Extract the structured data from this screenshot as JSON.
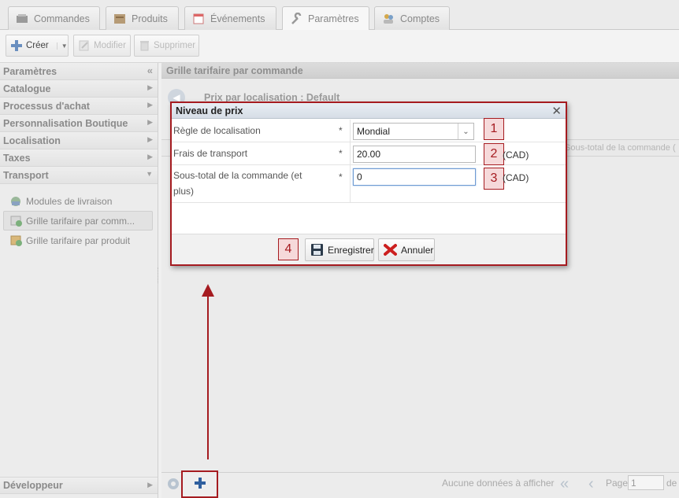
{
  "tabs": [
    {
      "label": "Commandes",
      "icon": "orders-icon"
    },
    {
      "label": "Produits",
      "icon": "products-icon"
    },
    {
      "label": "Événements",
      "icon": "events-icon"
    },
    {
      "label": "Paramètres",
      "icon": "wrench-icon",
      "active": true
    },
    {
      "label": "Comptes",
      "icon": "accounts-icon"
    }
  ],
  "toolbar": {
    "create_label": "Créer",
    "modify_label": "Modifier",
    "delete_label": "Supprimer"
  },
  "sidebar": {
    "header": "Paramètres",
    "sections": [
      "Catalogue",
      "Processus d'achat",
      "Personnalisation Boutique",
      "Localisation",
      "Taxes"
    ],
    "expanded_section": "Transport",
    "items": [
      {
        "label": "Modules de livraison",
        "icon": "shipping-modules-icon"
      },
      {
        "label": "Grille tarifaire par comm...",
        "icon": "price-grid-order-icon",
        "active": true
      },
      {
        "label": "Grille tarifaire par produit",
        "icon": "price-grid-product-icon"
      }
    ],
    "developer": "Développeur"
  },
  "main": {
    "title": "Grille tarifaire par commande",
    "subtitle": "Prix par localisation : Default",
    "grid_column": "Sous-total de la commande (",
    "pager": {
      "no_data": "Aucune données à afficher",
      "page_label": "Page",
      "page_value": "1",
      "of_label": "de"
    }
  },
  "dialog": {
    "title": "Niveau de prix",
    "fields": {
      "rule_label": "Règle de localisation",
      "rule_value": "Mondial",
      "shipping_label": "Frais de transport",
      "shipping_value": "20.00",
      "shipping_unit": "(CAD)",
      "subtotal_label_1": "Sous-total de la commande (et",
      "subtotal_label_2": "plus)",
      "subtotal_value": "0",
      "subtotal_unit": "(CAD)",
      "required": "*"
    },
    "save_label": "Enregistrer",
    "cancel_label": "Annuler"
  },
  "annotations": [
    "1",
    "2",
    "3",
    "4"
  ],
  "colors": {
    "annotation": "#a51b20",
    "badge_fill": "#f6d9da"
  }
}
